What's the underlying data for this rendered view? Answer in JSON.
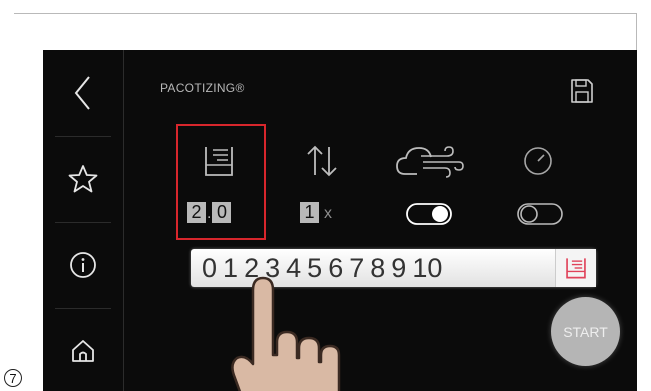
{
  "step_number": "7",
  "header": {
    "title": "PACOTIZING®"
  },
  "settings": {
    "depth_digit_1": "2",
    "depth_digit_2": "0",
    "repeat_count": "1",
    "repeat_suffix": "x"
  },
  "selector": {
    "digits": [
      "0",
      "1",
      "2",
      "3",
      "4",
      "5",
      "6",
      "7",
      "8",
      "9",
      "10"
    ]
  },
  "start_button": {
    "label": "START"
  },
  "icons": {
    "back": "chevron-left-icon",
    "favorites": "star-icon",
    "info": "info-icon",
    "home": "home-icon",
    "save": "floppy-disk-icon",
    "depth": "layer-depth-icon",
    "repeat": "up-down-arrows-icon",
    "air": "cloud-wind-icon",
    "speed": "gauge-icon"
  },
  "toggles": {
    "air_on": true,
    "speed_on": false
  },
  "colors": {
    "screen_bg": "#0b0b0b",
    "highlight": "#d8262c",
    "accent_icon": "#e0425a"
  }
}
